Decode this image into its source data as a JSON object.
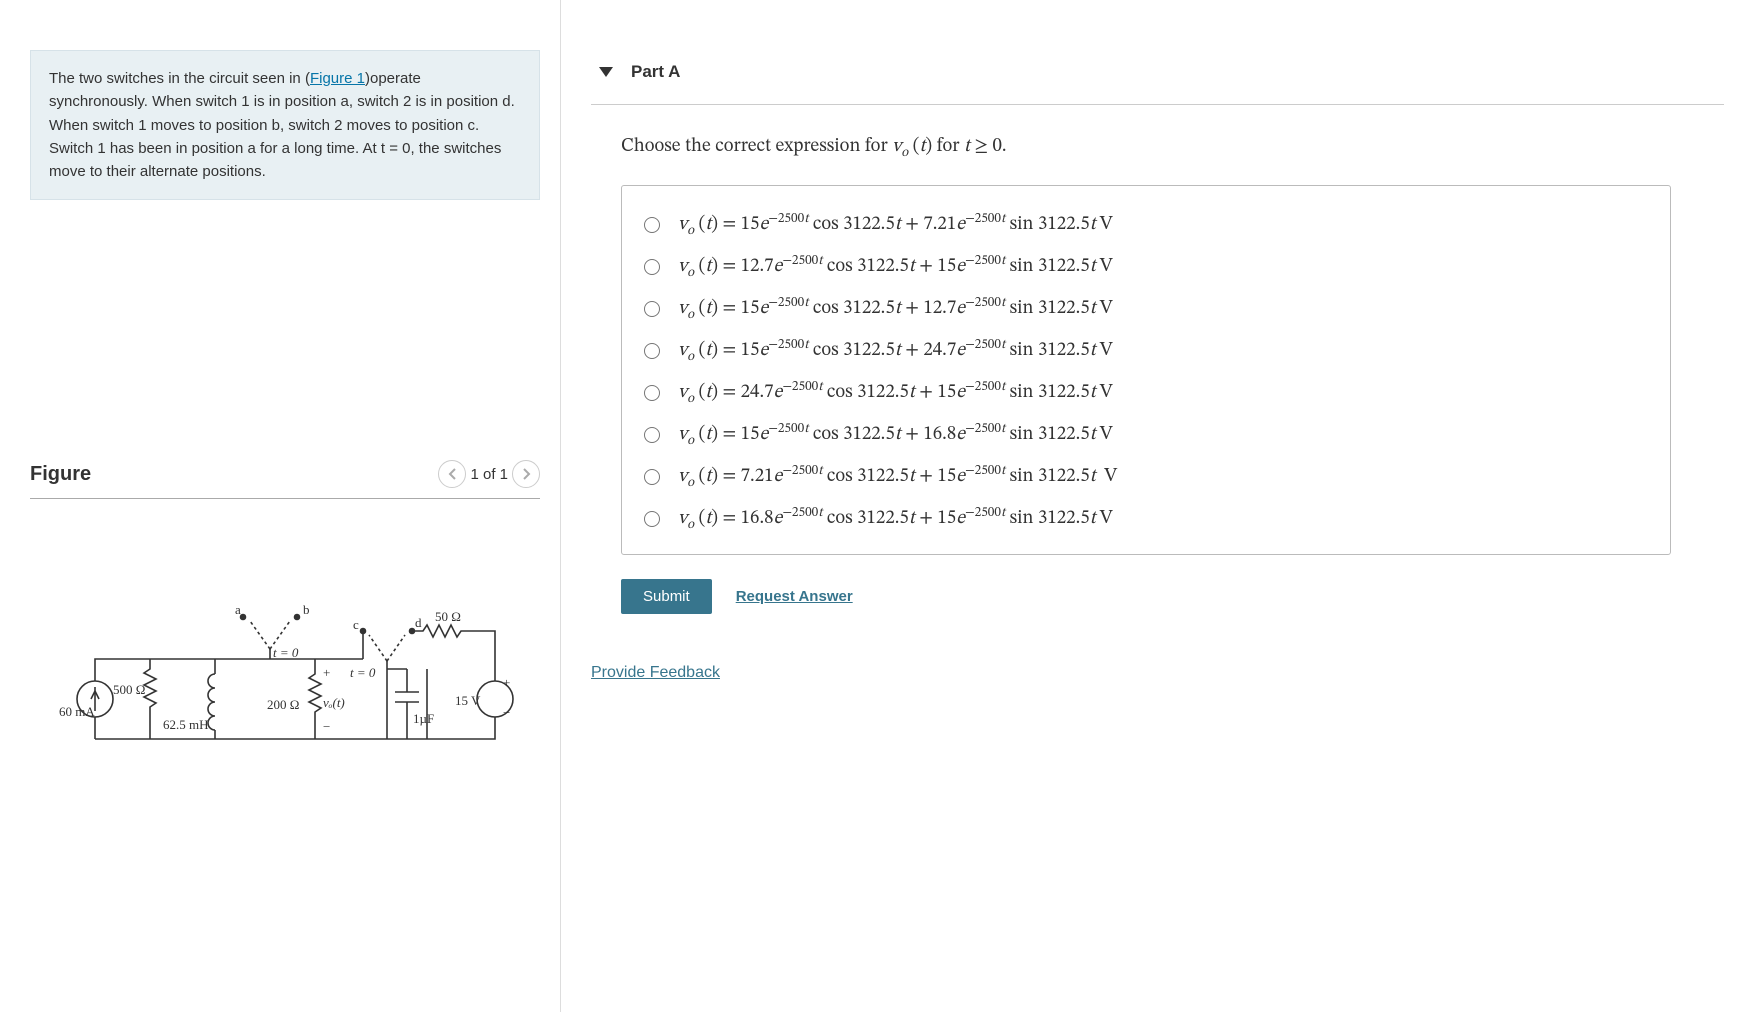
{
  "problem": {
    "pre_link": "The two switches in the circuit seen in (",
    "link_text": "Figure 1",
    "post_link": ")operate synchronously. When switch 1 is in position a, switch 2 is in position d. When switch 1 moves to position b, switch 2 moves to position c. Switch 1 has been in position a for a long time. At t = 0, the switches move to their alternate positions."
  },
  "figure": {
    "title": "Figure",
    "pager": "1 of 1",
    "labels": {
      "a": "a",
      "b": "b",
      "c": "c",
      "d": "d",
      "r500": "500 Ω",
      "i60": "60 mA",
      "l625": "62.5 mH",
      "t0_1": "t = 0",
      "t0_2": "t = 0",
      "r200": "200 Ω",
      "vo": "vₒ(t)",
      "plus": "+",
      "minus": "−",
      "r50": "50 Ω",
      "v15": "15 V",
      "c1": "1µF",
      "vplus": "+",
      "vminus": "−"
    }
  },
  "part": {
    "heading": "Part A",
    "prompt_html": "Choose the correct expression for vₒ (t) for t ≥ 0."
  },
  "options": [
    "vₒ (t) = 15e⁻²⁵⁰⁰ᵗ cos 3122.5t + 7.21e⁻²⁵⁰⁰ᵗ sin 3122.5t V",
    "vₒ (t) = 12.7e⁻²⁵⁰⁰ᵗ cos 3122.5t + 15e⁻²⁵⁰⁰ᵗ sin 3122.5t V",
    "vₒ (t) = 15e⁻²⁵⁰⁰ᵗ cos 3122.5t + 12.7e⁻²⁵⁰⁰ᵗ sin 3122.5t V",
    "vₒ (t) = 15e⁻²⁵⁰⁰ᵗ cos 3122.5t + 24.7e⁻²⁵⁰⁰ᵗ sin 3122.5t V",
    "vₒ (t) = 24.7e⁻²⁵⁰⁰ᵗ cos 3122.5t + 15e⁻²⁵⁰⁰ᵗ sin 3122.5t V",
    "vₒ (t) = 15e⁻²⁵⁰⁰ᵗ cos 3122.5t + 16.8e⁻²⁵⁰⁰ᵗ sin 3122.5t V",
    "vₒ (t) = 7.21e⁻²⁵⁰⁰ᵗ cos 3122.5t + 15e⁻²⁵⁰⁰ᵗ sin 3122.5t  V",
    "vₒ (t) = 16.8e⁻²⁵⁰⁰ᵗ cos 3122.5t + 15e⁻²⁵⁰⁰ᵗ sin 3122.5t V"
  ],
  "buttons": {
    "submit": "Submit",
    "request": "Request Answer",
    "feedback": "Provide Feedback"
  }
}
